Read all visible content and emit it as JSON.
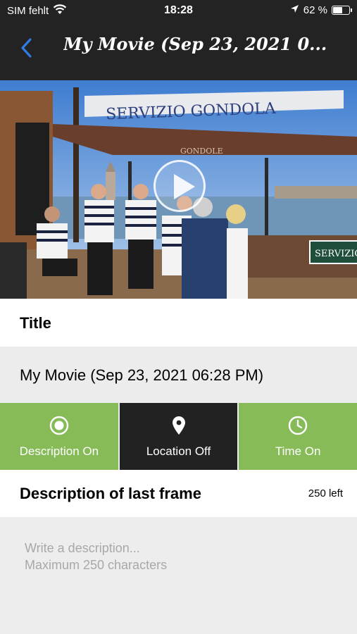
{
  "status_bar": {
    "carrier": "SIM fehlt",
    "time": "18:28",
    "battery_percent": "62 %",
    "battery_level": 0.62
  },
  "nav": {
    "title": "My Movie (Sep 23, 2021 0...",
    "back_icon": "chevron-left-icon"
  },
  "video": {
    "sign_top": "SERVIZIO GONDOLA",
    "awning": "GONDOLE",
    "sign_right": "SERVIZIO"
  },
  "title_section": {
    "header": "Title",
    "value": "My Movie (Sep 23, 2021 06:28 PM)"
  },
  "toggles": [
    {
      "label": "Description On",
      "icon": "radio-on-icon",
      "state": "on",
      "color": "#86bb58"
    },
    {
      "label": "Location Off",
      "icon": "location-pin-icon",
      "state": "off",
      "color": "#222222"
    },
    {
      "label": "Time On",
      "icon": "clock-icon",
      "state": "on",
      "color": "#86bb58"
    }
  ],
  "description": {
    "header": "Description of last frame",
    "remaining": "250 left",
    "placeholder": "Write a description...\nMaximum 250 characters",
    "value": ""
  },
  "colors": {
    "accent_blue": "#2f7de1",
    "toggle_on": "#86bb58",
    "toggle_off": "#222222"
  }
}
